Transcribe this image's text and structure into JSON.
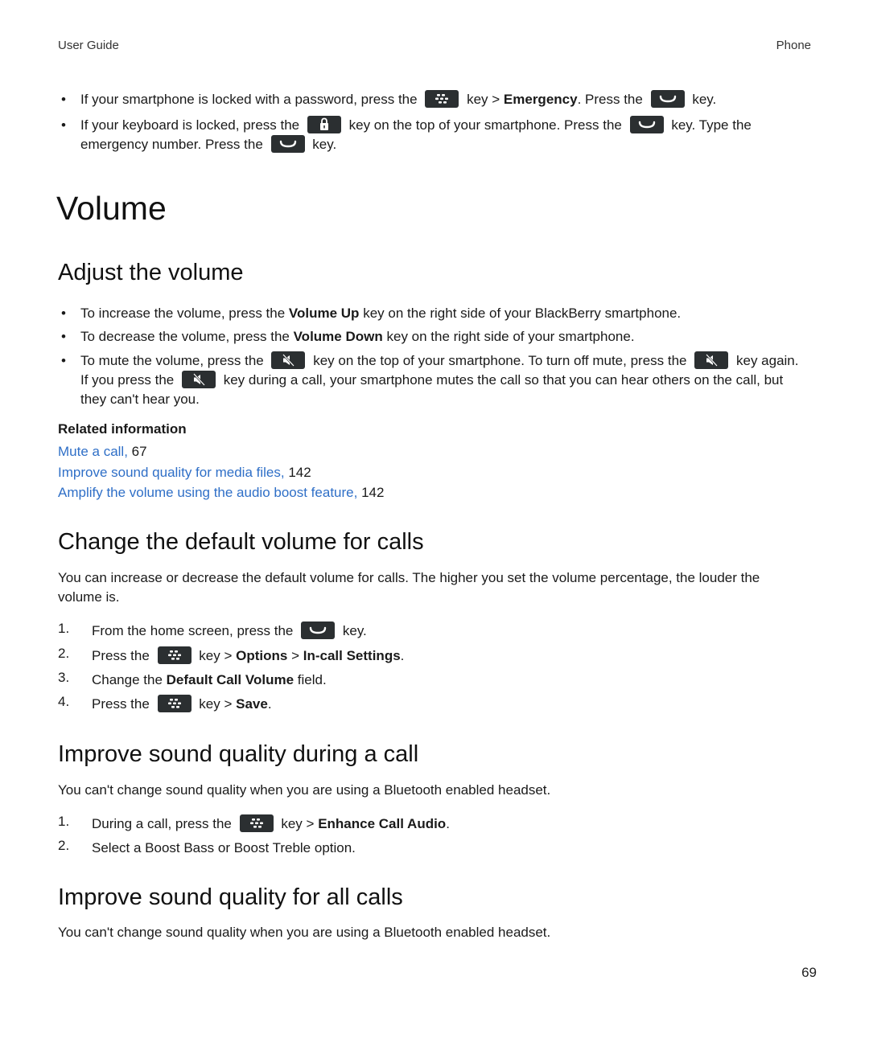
{
  "header": {
    "left": "User Guide",
    "right": "Phone"
  },
  "intro_bullets": [
    {
      "a": "If your smartphone is locked with a password, press the",
      "key1": "menu-key",
      "b": "key >",
      "bold": "Emergency",
      "c": ". Press the",
      "key2": "send-key",
      "d": "key."
    },
    {
      "a": "If your keyboard is locked, press the",
      "key1": "lock-key",
      "b": "key on the top of your smartphone. Press the",
      "key2": "send-key",
      "c": "key. Type the",
      "d": "emergency number. Press the",
      "key3": "send-key",
      "e": "key."
    }
  ],
  "title": "Volume",
  "sections": {
    "adjust": {
      "heading": "Adjust the volume",
      "bullets": [
        {
          "a": "To increase the volume, press the",
          "bold": "Volume Up",
          "b": "key on the right side of your BlackBerry smartphone."
        },
        {
          "a": "To decrease the volume, press the",
          "bold": "Volume Down",
          "b": "key on the right side of your smartphone."
        },
        {
          "a": "To mute the volume, press the",
          "b": "key on the top of your smartphone. To turn off mute, press the",
          "c": "key again.",
          "d": "If you press the",
          "e": "key during a call, your smartphone mutes the call so that you can hear others on the call, but",
          "f": "they can't hear you."
        }
      ],
      "related_title": "Related information",
      "related": [
        {
          "link": "Mute a call,",
          "page": "67"
        },
        {
          "link": "Improve sound quality for media files,",
          "page": "142"
        },
        {
          "link": "Amplify the volume using the audio boost feature,",
          "page": "142"
        }
      ]
    },
    "default_volume": {
      "heading": "Change the default volume for calls",
      "intro": "You can increase or decrease the default volume for calls. The higher you set the volume percentage, the louder the volume is.",
      "steps": [
        {
          "num": "1.",
          "a": "From the home screen, press the",
          "b": "key."
        },
        {
          "num": "2.",
          "a": "Press the",
          "b": "key >",
          "bold1": "Options",
          "c": ">",
          "bold2": "In-call Settings",
          "d": "."
        },
        {
          "num": "3.",
          "a": "Change the",
          "bold1": "Default Call Volume",
          "b": "field."
        },
        {
          "num": "4.",
          "a": "Press the",
          "b": "key >",
          "bold1": "Save",
          "c": "."
        }
      ]
    },
    "quality_during": {
      "heading": "Improve sound quality during a call",
      "intro": "You can't change sound quality when you are using a Bluetooth enabled headset.",
      "steps": [
        {
          "num": "1.",
          "a": "During a call, press the",
          "b": "key >",
          "bold1": "Enhance Call Audio",
          "c": "."
        },
        {
          "num": "2.",
          "a": "Select a Boost Bass or Boost Treble option."
        }
      ]
    },
    "quality_all": {
      "heading": "Improve sound quality for all calls",
      "intro": "You can't change sound quality when you are using a Bluetooth enabled headset."
    }
  },
  "page_number": "69"
}
